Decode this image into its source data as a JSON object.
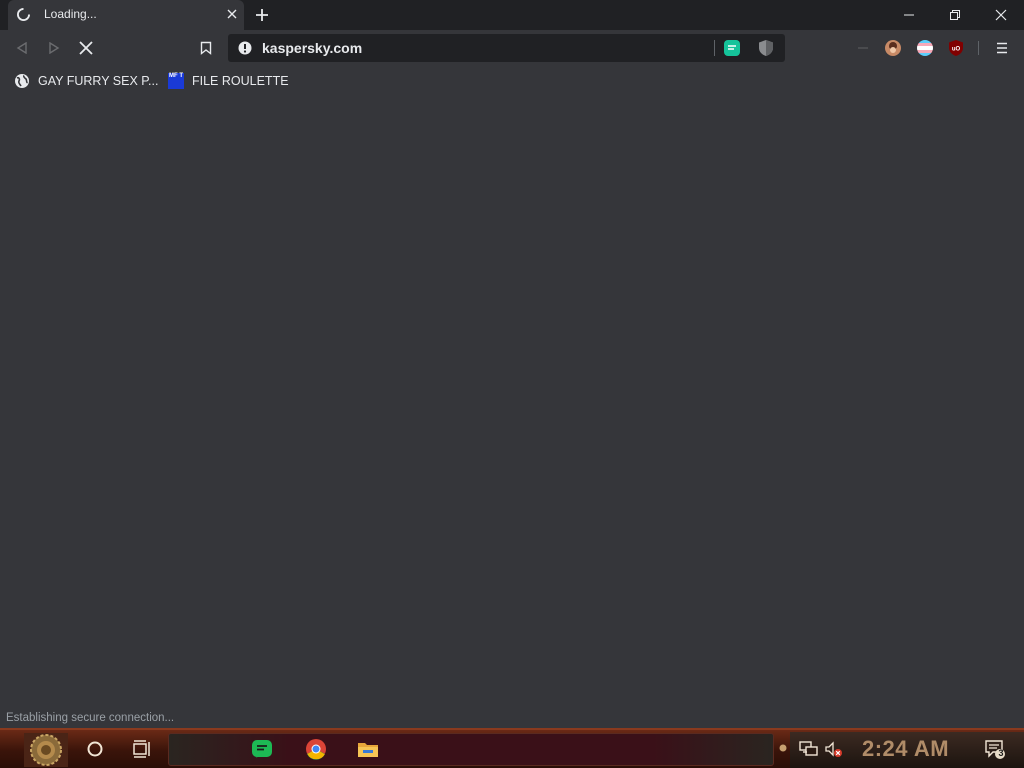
{
  "browser": {
    "tab": {
      "title": "Loading..."
    },
    "address": {
      "url": "kaspersky.com"
    },
    "bookmarks": [
      {
        "label": "GAY FURRY SEX P...",
        "icon": "globe-icon"
      },
      {
        "label": "FILE ROULETTE",
        "icon": "mft-badge-icon",
        "badge": "MF T"
      }
    ],
    "status": "Establishing secure connection..."
  },
  "taskbar": {
    "clock": "2:24 AM",
    "notifications_count": "3"
  },
  "colors": {
    "chrome_dark": "#202124",
    "chrome_surface": "#35363a",
    "spotify_green": "#1db954",
    "ublock_red": "#800000",
    "clock_bronze": "#b08c68"
  }
}
